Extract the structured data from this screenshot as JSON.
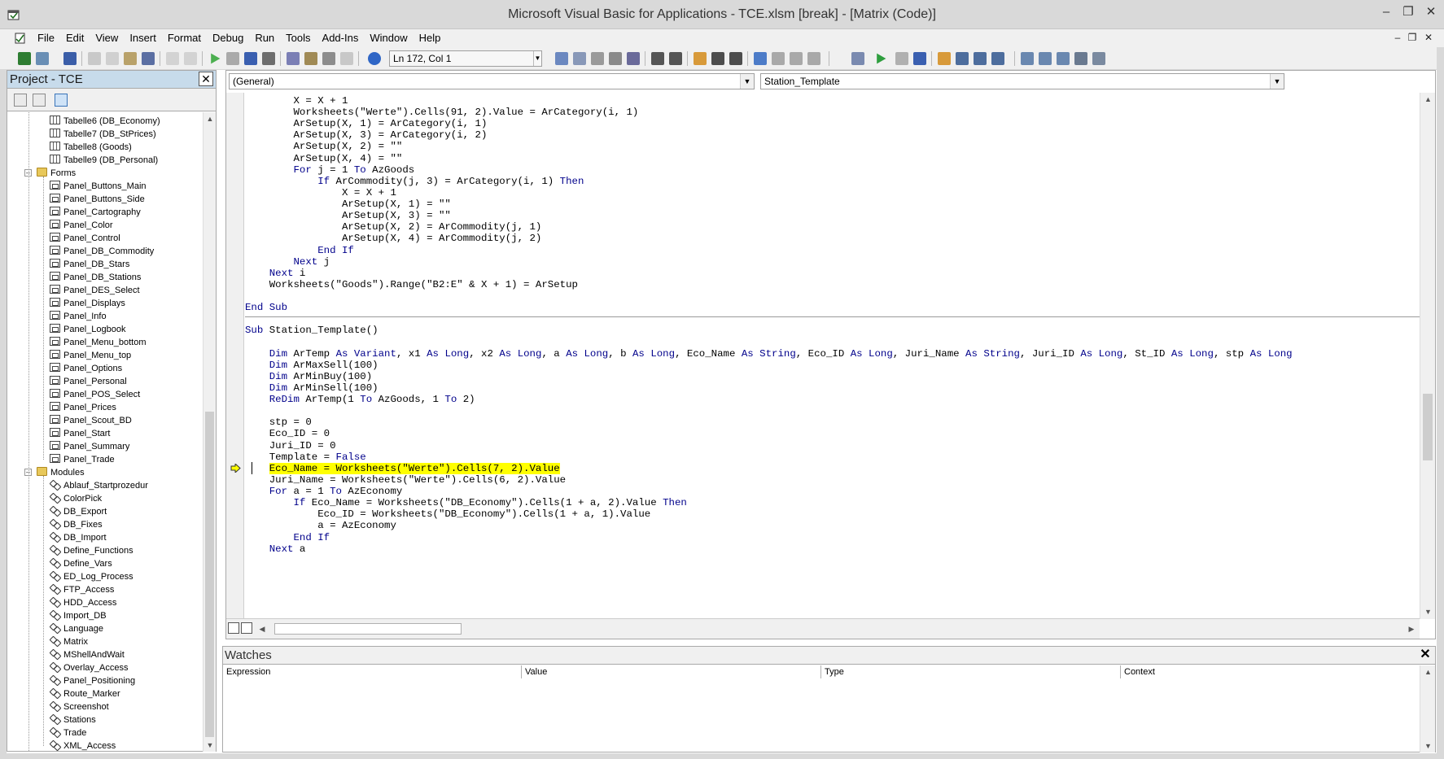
{
  "window": {
    "title": "Microsoft Visual Basic for Applications - TCE.xlsm [break] - [Matrix (Code)]",
    "minimize": "–",
    "maximize": "❐",
    "close": "✕"
  },
  "menu": [
    "File",
    "Edit",
    "View",
    "Insert",
    "Format",
    "Debug",
    "Run",
    "Tools",
    "Add-Ins",
    "Window",
    "Help"
  ],
  "mdi_controls": {
    "minimize": "–",
    "restore": "❐",
    "close": "✕"
  },
  "toolbar": {
    "position": "Ln 172, Col 1"
  },
  "project": {
    "title": "Project - TCE",
    "close": "✕",
    "sheets": [
      "Tabelle6 (DB_Economy)",
      "Tabelle7 (DB_StPrices)",
      "Tabelle8 (Goods)",
      "Tabelle9 (DB_Personal)"
    ],
    "forms_label": "Forms",
    "forms": [
      "Panel_Buttons_Main",
      "Panel_Buttons_Side",
      "Panel_Cartography",
      "Panel_Color",
      "Panel_Control",
      "Panel_DB_Commodity",
      "Panel_DB_Stars",
      "Panel_DB_Stations",
      "Panel_DES_Select",
      "Panel_Displays",
      "Panel_Info",
      "Panel_Logbook",
      "Panel_Menu_bottom",
      "Panel_Menu_top",
      "Panel_Options",
      "Panel_Personal",
      "Panel_POS_Select",
      "Panel_Prices",
      "Panel_Scout_BD",
      "Panel_Start",
      "Panel_Summary",
      "Panel_Trade"
    ],
    "modules_label": "Modules",
    "modules": [
      "Ablauf_Startprozedur",
      "ColorPick",
      "DB_Export",
      "DB_Fixes",
      "DB_Import",
      "Define_Functions",
      "Define_Vars",
      "ED_Log_Process",
      "FTP_Access",
      "HDD_Access",
      "Import_DB",
      "Language",
      "Matrix",
      "MShellAndWait",
      "Overlay_Access",
      "Panel_Positioning",
      "Route_Marker",
      "Screenshot",
      "Stations",
      "Trade",
      "XML_Access"
    ]
  },
  "code": {
    "object_combo": "(General)",
    "procedure_combo": "Station_Template",
    "lines": [
      [
        {
          "t": "        X = X + 1"
        }
      ],
      [
        {
          "t": "        Worksheets(\"Werte\").Cells(91, 2).Value = ArCategory(i, 1)"
        }
      ],
      [
        {
          "t": "        ArSetup(X, 1) = ArCategory(i, 1)"
        }
      ],
      [
        {
          "t": "        ArSetup(X, 3) = ArCategory(i, 2)"
        }
      ],
      [
        {
          "t": "        ArSetup(X, 2) = \"\""
        }
      ],
      [
        {
          "t": "        ArSetup(X, 4) = \"\""
        }
      ],
      [
        {
          "t": "        "
        },
        {
          "t": "For",
          "k": 1
        },
        {
          "t": " j = 1 "
        },
        {
          "t": "To",
          "k": 1
        },
        {
          "t": " AzGoods"
        }
      ],
      [
        {
          "t": "            "
        },
        {
          "t": "If",
          "k": 1
        },
        {
          "t": " ArCommodity(j, 3) = ArCategory(i, 1) "
        },
        {
          "t": "Then",
          "k": 1
        }
      ],
      [
        {
          "t": "                X = X + 1"
        }
      ],
      [
        {
          "t": "                ArSetup(X, 1) = \"\""
        }
      ],
      [
        {
          "t": "                ArSetup(X, 3) = \"\""
        }
      ],
      [
        {
          "t": "                ArSetup(X, 2) = ArCommodity(j, 1)"
        }
      ],
      [
        {
          "t": "                ArSetup(X, 4) = ArCommodity(j, 2)"
        }
      ],
      [
        {
          "t": "            "
        },
        {
          "t": "End If",
          "k": 1
        }
      ],
      [
        {
          "t": "        "
        },
        {
          "t": "Next",
          "k": 1
        },
        {
          "t": " j"
        }
      ],
      [
        {
          "t": "    "
        },
        {
          "t": "Next",
          "k": 1
        },
        {
          "t": " i"
        }
      ],
      [
        {
          "t": "    Worksheets(\"Goods\").Range(\"B2:E\" & X + 1) = ArSetup"
        }
      ],
      [
        {
          "t": ""
        }
      ],
      [
        {
          "t": "End Sub",
          "k": 1
        }
      ],
      [
        {
          "t": ""
        }
      ],
      [
        {
          "t": "Sub",
          "k": 1
        },
        {
          "t": " Station_Template()"
        }
      ],
      [
        {
          "t": ""
        }
      ],
      [
        {
          "t": "    "
        },
        {
          "t": "Dim",
          "k": 1
        },
        {
          "t": " ArTemp "
        },
        {
          "t": "As",
          "k": 1
        },
        {
          "t": " "
        },
        {
          "t": "Variant",
          "k": 1
        },
        {
          "t": ", x1 "
        },
        {
          "t": "As",
          "k": 1
        },
        {
          "t": " "
        },
        {
          "t": "Long",
          "k": 1
        },
        {
          "t": ", x2 "
        },
        {
          "t": "As",
          "k": 1
        },
        {
          "t": " "
        },
        {
          "t": "Long",
          "k": 1
        },
        {
          "t": ", a "
        },
        {
          "t": "As",
          "k": 1
        },
        {
          "t": " "
        },
        {
          "t": "Long",
          "k": 1
        },
        {
          "t": ", b "
        },
        {
          "t": "As",
          "k": 1
        },
        {
          "t": " "
        },
        {
          "t": "Long",
          "k": 1
        },
        {
          "t": ", Eco_Name "
        },
        {
          "t": "As",
          "k": 1
        },
        {
          "t": " "
        },
        {
          "t": "String",
          "k": 1
        },
        {
          "t": ", Eco_ID "
        },
        {
          "t": "As",
          "k": 1
        },
        {
          "t": " "
        },
        {
          "t": "Long",
          "k": 1
        },
        {
          "t": ", Juri_Name "
        },
        {
          "t": "As",
          "k": 1
        },
        {
          "t": " "
        },
        {
          "t": "String",
          "k": 1
        },
        {
          "t": ", Juri_ID "
        },
        {
          "t": "As",
          "k": 1
        },
        {
          "t": " "
        },
        {
          "t": "Long",
          "k": 1
        },
        {
          "t": ", St_ID "
        },
        {
          "t": "As",
          "k": 1
        },
        {
          "t": " "
        },
        {
          "t": "Long",
          "k": 1
        },
        {
          "t": ", stp "
        },
        {
          "t": "As",
          "k": 1
        },
        {
          "t": " "
        },
        {
          "t": "Long",
          "k": 1
        }
      ],
      [
        {
          "t": "    "
        },
        {
          "t": "Dim",
          "k": 1
        },
        {
          "t": " ArMaxSell(100)"
        }
      ],
      [
        {
          "t": "    "
        },
        {
          "t": "Dim",
          "k": 1
        },
        {
          "t": " ArMinBuy(100)"
        }
      ],
      [
        {
          "t": "    "
        },
        {
          "t": "Dim",
          "k": 1
        },
        {
          "t": " ArMinSell(100)"
        }
      ],
      [
        {
          "t": "    "
        },
        {
          "t": "ReDim",
          "k": 1
        },
        {
          "t": " ArTemp(1 "
        },
        {
          "t": "To",
          "k": 1
        },
        {
          "t": " AzGoods, 1 "
        },
        {
          "t": "To",
          "k": 1
        },
        {
          "t": " 2)"
        }
      ],
      [
        {
          "t": ""
        }
      ],
      [
        {
          "t": "    stp = 0"
        }
      ],
      [
        {
          "t": "    Eco_ID = 0"
        }
      ],
      [
        {
          "t": "    Juri_ID = 0"
        }
      ],
      [
        {
          "t": "    Template = "
        },
        {
          "t": "False",
          "k": 1
        }
      ],
      [
        {
          "t": "    "
        },
        {
          "t": "Eco_Name = Worksheets(\"Werte\").Cells(7, 2).Value",
          "h": 1
        }
      ],
      [
        {
          "t": "    Juri_Name = Worksheets(\"Werte\").Cells(6, 2).Value"
        }
      ],
      [
        {
          "t": "    "
        },
        {
          "t": "For",
          "k": 1
        },
        {
          "t": " a = 1 "
        },
        {
          "t": "To",
          "k": 1
        },
        {
          "t": " AzEconomy"
        }
      ],
      [
        {
          "t": "        "
        },
        {
          "t": "If",
          "k": 1
        },
        {
          "t": " Eco_Name = Worksheets(\"DB_Economy\").Cells(1 + a, 2).Value "
        },
        {
          "t": "Then",
          "k": 1
        }
      ],
      [
        {
          "t": "            Eco_ID = Worksheets(\"DB_Economy\").Cells(1 + a, 1).Value"
        }
      ],
      [
        {
          "t": "            a = AzEconomy"
        }
      ],
      [
        {
          "t": "        "
        },
        {
          "t": "End If",
          "k": 1
        }
      ],
      [
        {
          "t": "    "
        },
        {
          "t": "Next",
          "k": 1
        },
        {
          "t": " a"
        }
      ]
    ]
  },
  "watches": {
    "title": "Watches",
    "close": "✕",
    "columns": [
      "Expression",
      "Value",
      "Type",
      "Context"
    ]
  },
  "colors": {
    "keyword": "#00008b",
    "highlight": "#ffff00",
    "panel_header": "#c7dbeb"
  }
}
